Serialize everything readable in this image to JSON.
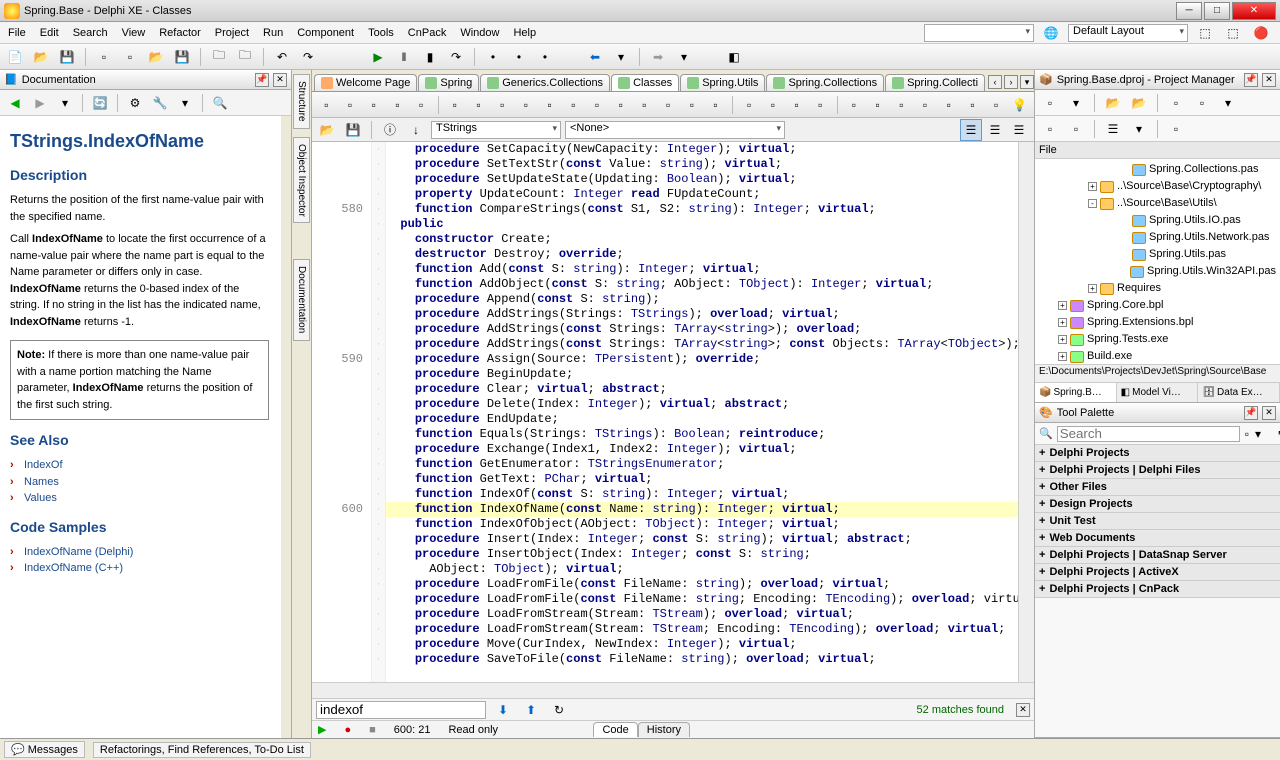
{
  "window": {
    "title": "Spring.Base - Delphi XE - Classes"
  },
  "menu": [
    "File",
    "Edit",
    "Search",
    "View",
    "Refactor",
    "Project",
    "Run",
    "Component",
    "Tools",
    "CnPack",
    "Window",
    "Help"
  ],
  "layout_combo": "Default Layout",
  "doc_panel": {
    "title": "Documentation"
  },
  "doc": {
    "h1": "TStrings.IndexOfName",
    "h2_desc": "Description",
    "p1": "Returns the position of the first name-value pair with the specified name.",
    "p2a": "Call ",
    "p2b": "IndexOfName",
    "p2c": " to locate the first occurrence of a name-value pair where the name part is equal to the Name parameter or differs only in case. ",
    "p2d": "IndexOfName",
    "p2e": " returns the 0-based index of the string. If no string in the list has the indicated name, ",
    "p2f": "IndexOfName",
    "p2g": " returns -1.",
    "note_b": "Note:",
    "note_t1": " If there is more than one name-value pair with a name portion matching the Name parameter, ",
    "note_b2": "IndexOfName",
    "note_t2": " returns the position of the first such string.",
    "h2_see": "See Also",
    "see": [
      "IndexOf",
      "Names",
      "Values"
    ],
    "h2_code": "Code Samples",
    "samples": [
      "IndexOfName (Delphi)",
      "IndexOfName (C++)"
    ]
  },
  "side_tabs": [
    "Structure",
    "Object Inspector",
    "Documentation"
  ],
  "editor_tabs": [
    "Welcome Page",
    "Spring",
    "Generics.Collections",
    "Classes",
    "Spring.Utils",
    "Spring.Collections",
    "Spring.Collecti"
  ],
  "editor_combo1": "TStrings",
  "editor_combo2": "<None>",
  "code_lines": [
    {
      "n": "",
      "t": "    procedure SetCapacity(NewCapacity: Integer); virtual;"
    },
    {
      "n": "",
      "t": "    procedure SetTextStr(const Value: string); virtual;"
    },
    {
      "n": "",
      "t": "    procedure SetUpdateState(Updating: Boolean); virtual;"
    },
    {
      "n": "",
      "t": "    property UpdateCount: Integer read FUpdateCount;"
    },
    {
      "n": "580",
      "t": "    function CompareStrings(const S1, S2: string): Integer; virtual;"
    },
    {
      "n": "",
      "t": "  public"
    },
    {
      "n": "",
      "t": "    constructor Create;"
    },
    {
      "n": "",
      "t": "    destructor Destroy; override;"
    },
    {
      "n": "",
      "t": "    function Add(const S: string): Integer; virtual;"
    },
    {
      "n": "",
      "t": "    function AddObject(const S: string; AObject: TObject): Integer; virtual;"
    },
    {
      "n": "",
      "t": "    procedure Append(const S: string);"
    },
    {
      "n": "",
      "t": "    procedure AddStrings(Strings: TStrings); overload; virtual;"
    },
    {
      "n": "",
      "t": "    procedure AddStrings(const Strings: TArray<string>); overload;"
    },
    {
      "n": "",
      "t": "    procedure AddStrings(const Strings: TArray<string>; const Objects: TArray<TObject>);"
    },
    {
      "n": "590",
      "t": "    procedure Assign(Source: TPersistent); override;"
    },
    {
      "n": "",
      "t": "    procedure BeginUpdate;"
    },
    {
      "n": "",
      "t": "    procedure Clear; virtual; abstract;"
    },
    {
      "n": "",
      "t": "    procedure Delete(Index: Integer); virtual; abstract;"
    },
    {
      "n": "",
      "t": "    procedure EndUpdate;"
    },
    {
      "n": "",
      "t": "    function Equals(Strings: TStrings): Boolean; reintroduce;"
    },
    {
      "n": "",
      "t": "    procedure Exchange(Index1, Index2: Integer); virtual;"
    },
    {
      "n": "",
      "t": "    function GetEnumerator: TStringsEnumerator;"
    },
    {
      "n": "",
      "t": "    function GetText: PChar; virtual;"
    },
    {
      "n": "",
      "t": "    function IndexOf(const S: string): Integer; virtual;"
    },
    {
      "n": "600",
      "t": "    function IndexOfName(const Name: string): Integer; virtual;",
      "hl": true
    },
    {
      "n": "",
      "t": "    function IndexOfObject(AObject: TObject): Integer; virtual;"
    },
    {
      "n": "",
      "t": "    procedure Insert(Index: Integer; const S: string); virtual; abstract;"
    },
    {
      "n": "",
      "t": "    procedure InsertObject(Index: Integer; const S: string;"
    },
    {
      "n": "",
      "t": "      AObject: TObject); virtual;"
    },
    {
      "n": "",
      "t": "    procedure LoadFromFile(const FileName: string); overload; virtual;"
    },
    {
      "n": "",
      "t": "    procedure LoadFromFile(const FileName: string; Encoding: TEncoding); overload; virtu"
    },
    {
      "n": "",
      "t": "    procedure LoadFromStream(Stream: TStream); overload; virtual;"
    },
    {
      "n": "",
      "t": "    procedure LoadFromStream(Stream: TStream; Encoding: TEncoding); overload; virtual;"
    },
    {
      "n": "",
      "t": "    procedure Move(CurIndex, NewIndex: Integer); virtual;"
    },
    {
      "n": "",
      "t": "    procedure SaveToFile(const FileName: string); overload; virtual;"
    }
  ],
  "find": {
    "value": "indexof",
    "matches": "52 matches found"
  },
  "status": {
    "pos": "600: 21",
    "mode": "Read only"
  },
  "bottom_tabs": [
    "Code",
    "History"
  ],
  "pm": {
    "title": "Spring.Base.dproj - Project Manager",
    "file_label": "File",
    "tree": [
      {
        "indent": 76,
        "exp": "",
        "ic": "pas",
        "label": "Spring.Collections.pas"
      },
      {
        "indent": 46,
        "exp": "+",
        "ic": "",
        "label": "..\\Source\\Base\\Cryptography\\"
      },
      {
        "indent": 46,
        "exp": "-",
        "ic": "",
        "label": "..\\Source\\Base\\Utils\\"
      },
      {
        "indent": 76,
        "exp": "",
        "ic": "pas",
        "label": "Spring.Utils.IO.pas"
      },
      {
        "indent": 76,
        "exp": "",
        "ic": "pas",
        "label": "Spring.Utils.Network.pas"
      },
      {
        "indent": 76,
        "exp": "",
        "ic": "pas",
        "label": "Spring.Utils.pas"
      },
      {
        "indent": 76,
        "exp": "",
        "ic": "pas",
        "label": "Spring.Utils.Win32API.pas"
      },
      {
        "indent": 46,
        "exp": "+",
        "ic": "",
        "label": "Requires"
      },
      {
        "indent": 16,
        "exp": "+",
        "ic": "bpl",
        "label": "Spring.Core.bpl"
      },
      {
        "indent": 16,
        "exp": "+",
        "ic": "bpl",
        "label": "Spring.Extensions.bpl"
      },
      {
        "indent": 16,
        "exp": "+",
        "ic": "exe",
        "label": "Spring.Tests.exe"
      },
      {
        "indent": 16,
        "exp": "+",
        "ic": "exe",
        "label": "Build.exe"
      }
    ],
    "path": "E:\\Documents\\Projects\\DevJet\\Spring\\Source\\Base",
    "tabs": [
      "Spring.B…",
      "Model Vi…",
      "Data Ex…"
    ]
  },
  "palette": {
    "title": "Tool Palette",
    "search_placeholder": "Search",
    "cats": [
      "Delphi Projects",
      "Delphi Projects | Delphi Files",
      "Other Files",
      "Design Projects",
      "Unit Test",
      "Web Documents",
      "Delphi Projects | DataSnap Server",
      "Delphi Projects | ActiveX",
      "Delphi Projects | CnPack"
    ]
  },
  "statusbar": {
    "messages": "Messages",
    "refs": "Refactorings, Find References, To-Do List"
  }
}
